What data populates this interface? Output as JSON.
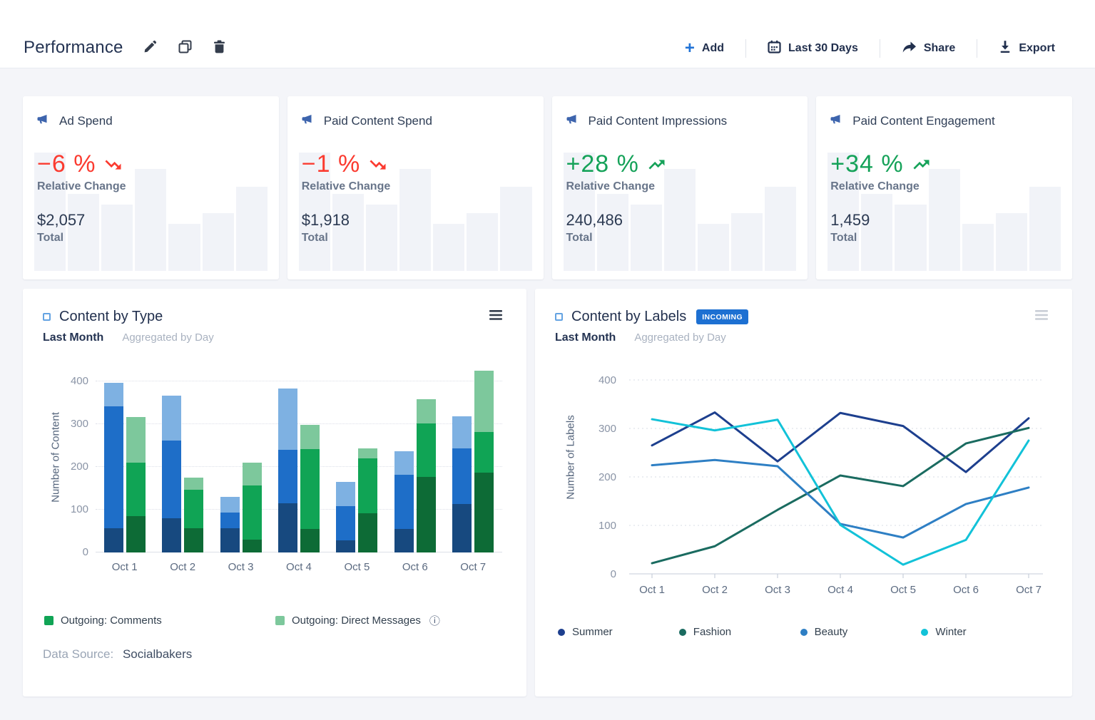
{
  "toolbar": {
    "title": "Performance",
    "add_label": "Add",
    "date_range_label": "Last 30 Days",
    "share_label": "Share",
    "export_label": "Export"
  },
  "kpi_sparkline_rel_heights": [
    100,
    65,
    56,
    86,
    40,
    49,
    71
  ],
  "kpi_cards": [
    {
      "title": "Ad Spend",
      "change": "−6 %",
      "direction": "down",
      "change_label": "Relative Change",
      "value": "$2,057",
      "value_label": "Total"
    },
    {
      "title": "Paid Content Spend",
      "change": "−1 %",
      "direction": "down",
      "change_label": "Relative Change",
      "value": "$1,918",
      "value_label": "Total"
    },
    {
      "title": "Paid Content Impressions",
      "change": "+28 %",
      "direction": "up",
      "change_label": "Relative Change",
      "value": "240,486",
      "value_label": "Total"
    },
    {
      "title": "Paid Content Engagement",
      "change": "+34 %",
      "direction": "up",
      "change_label": "Relative Change",
      "value": "1,459",
      "value_label": "Total"
    }
  ],
  "type_chart": {
    "title": "Content by Type",
    "period": "Last Month",
    "aggregation": "Aggregated by Day",
    "legend": [
      {
        "label": "Outgoing: Comments",
        "color_key": "bar_green_mid",
        "info_icon": false
      },
      {
        "label": "Outgoing: Direct Messages",
        "color_key": "bar_green_light",
        "info_icon": true
      }
    ],
    "data_source_label": "Data Source:",
    "data_source_value": "Socialbakers"
  },
  "labels_chart": {
    "title": "Content by Labels",
    "badge": "INCOMING",
    "period": "Last Month",
    "aggregation": "Aggregated by Day"
  },
  "chart_data": [
    {
      "type": "bar",
      "title": "Content by Type",
      "categories": [
        "Oct 1",
        "Oct 2",
        "Oct 3",
        "Oct 4",
        "Oct 5",
        "Oct 6",
        "Oct 7"
      ],
      "xlabel": "",
      "ylabel": "Number of Content",
      "ylim": [
        0,
        400
      ],
      "yticks": [
        0,
        100,
        200,
        300,
        400
      ],
      "grid": "dotted-horizontal",
      "stacked": true,
      "stacks": [
        {
          "id": "blue-stack",
          "segments": [
            {
              "color_key": "bar_blue_dark",
              "values": [
                57,
                80,
                57,
                115,
                28,
                55,
                113
              ]
            },
            {
              "color_key": "bar_blue_mid",
              "values": [
                285,
                182,
                36,
                125,
                81,
                127,
                130
              ]
            },
            {
              "color_key": "bar_blue_light",
              "values": [
                55,
                105,
                37,
                143,
                56,
                55,
                75
              ]
            }
          ]
        },
        {
          "id": "green-stack",
          "segments": [
            {
              "color_key": "bar_green_dark",
              "values": [
                85,
                57,
                30,
                55,
                92,
                177,
                186
              ]
            },
            {
              "color_key": "bar_green_mid",
              "values": [
                125,
                89,
                127,
                186,
                128,
                125,
                95
              ]
            },
            {
              "color_key": "bar_green_light",
              "values": [
                107,
                29,
                53,
                58,
                23,
                57,
                144
              ]
            }
          ]
        }
      ]
    },
    {
      "type": "line",
      "title": "Content by Labels",
      "x": [
        "Oct 1",
        "Oct 2",
        "Oct 3",
        "Oct 4",
        "Oct 5",
        "Oct 6",
        "Oct 7"
      ],
      "xlabel": "",
      "ylabel": "Number of Labels",
      "ylim": [
        0,
        400
      ],
      "yticks": [
        0,
        100,
        200,
        300,
        400
      ],
      "grid": "dotted-horizontal",
      "legend_position": "bottom",
      "series": [
        {
          "name": "Summer",
          "color_key": "line_summer",
          "values": [
            265,
            333,
            232,
            332,
            305,
            210,
            321
          ]
        },
        {
          "name": "Fashion",
          "color_key": "line_fashion",
          "values": [
            22,
            57,
            132,
            203,
            181,
            269,
            301
          ]
        },
        {
          "name": "Beauty",
          "color_key": "line_beauty",
          "values": [
            224,
            235,
            222,
            103,
            75,
            144,
            178
          ]
        },
        {
          "name": "Winter",
          "color_key": "line_winter",
          "values": [
            319,
            296,
            318,
            101,
            19,
            70,
            275
          ]
        }
      ]
    }
  ],
  "colors": {
    "accent_blue": "#2173d6",
    "badge_blue": "#1d70d2",
    "negative_red": "#fb3b30",
    "positive_green": "#15a259",
    "kpi_icon_blue": "#3d64ad",
    "sparkline_bar": "#f1f3f8",
    "bar_blue_dark": "#17497f",
    "bar_blue_mid": "#1e6ec8",
    "bar_blue_light": "#7eb1e2",
    "bar_green_dark": "#0d6b36",
    "bar_green_mid": "#10a455",
    "bar_green_light": "#7dc89c",
    "line_summer": "#1d3f8e",
    "line_fashion": "#1a6b60",
    "line_beauty": "#2e7fc4",
    "line_winter": "#12c2d8"
  }
}
